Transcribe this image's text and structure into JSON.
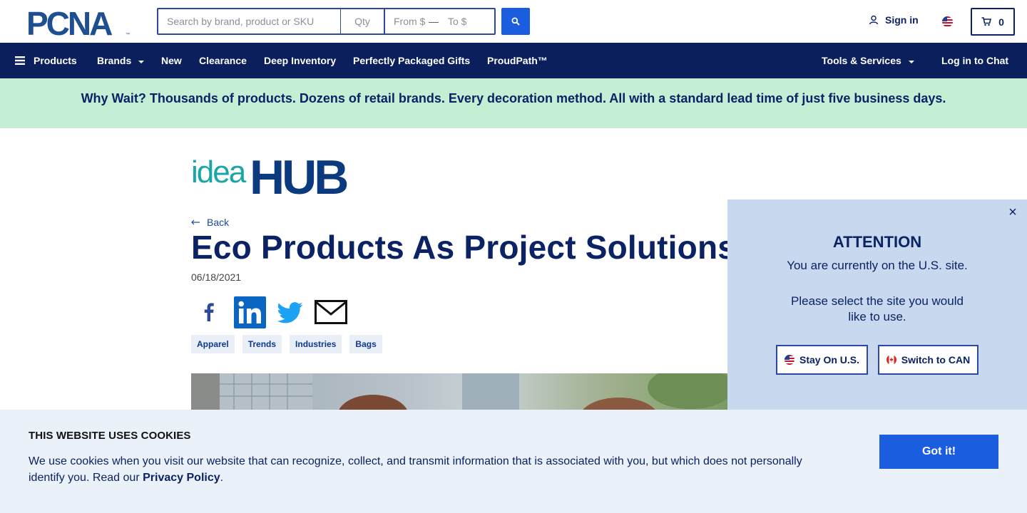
{
  "header": {
    "logo_text": "PCNA",
    "search": {
      "placeholder": "Search by brand, product or SKU",
      "value": ""
    },
    "qty": {
      "placeholder": "Qty"
    },
    "price_from": {
      "placeholder": "From $"
    },
    "price_to": {
      "placeholder": "To $"
    },
    "price_separator": "—",
    "signin_label": "Sign in",
    "cart_count": "0"
  },
  "nav": {
    "products": "Products",
    "brands": "Brands",
    "new": "New",
    "clearance": "Clearance",
    "deep_inventory": "Deep Inventory",
    "gifts": "Perfectly Packaged Gifts",
    "proudpath": "ProudPath™",
    "tools": "Tools & Services",
    "chat": "Log in to Chat"
  },
  "banner": {
    "text": "Why Wait? Thousands of products. Dozens of retail brands. Every decoration method. All with a standard lead time of just five business days."
  },
  "article": {
    "brand_logo": "ideaHUB",
    "back_label": "Back",
    "title": "Eco Products As Project Solutions",
    "date": "06/18/2021",
    "tags": [
      "Apparel",
      "Trends",
      "Industries",
      "Bags"
    ]
  },
  "attention": {
    "close": "×",
    "title": "ATTENTION",
    "line1": "You are currently on the U.S. site.",
    "line2": "Please select the site you would like to use.",
    "stay_label": "Stay On U.S.",
    "switch_label": "Switch to CAN"
  },
  "cookie": {
    "title": "THIS WEBSITE USES COOKIES",
    "text": "We use cookies when you visit our website that can recognize, collect, and transmit information that is associated with you, but which does not personally identify you. Read our",
    "link": "Privacy Policy",
    "period": ".",
    "button": "Got it!"
  },
  "colors": {
    "navy": "#0b1f5c",
    "brand_blue": "#1a5dde",
    "banner_green": "#c4efd5",
    "modal_bg": "#c8d8ee",
    "teal": "#1aa6a6"
  }
}
